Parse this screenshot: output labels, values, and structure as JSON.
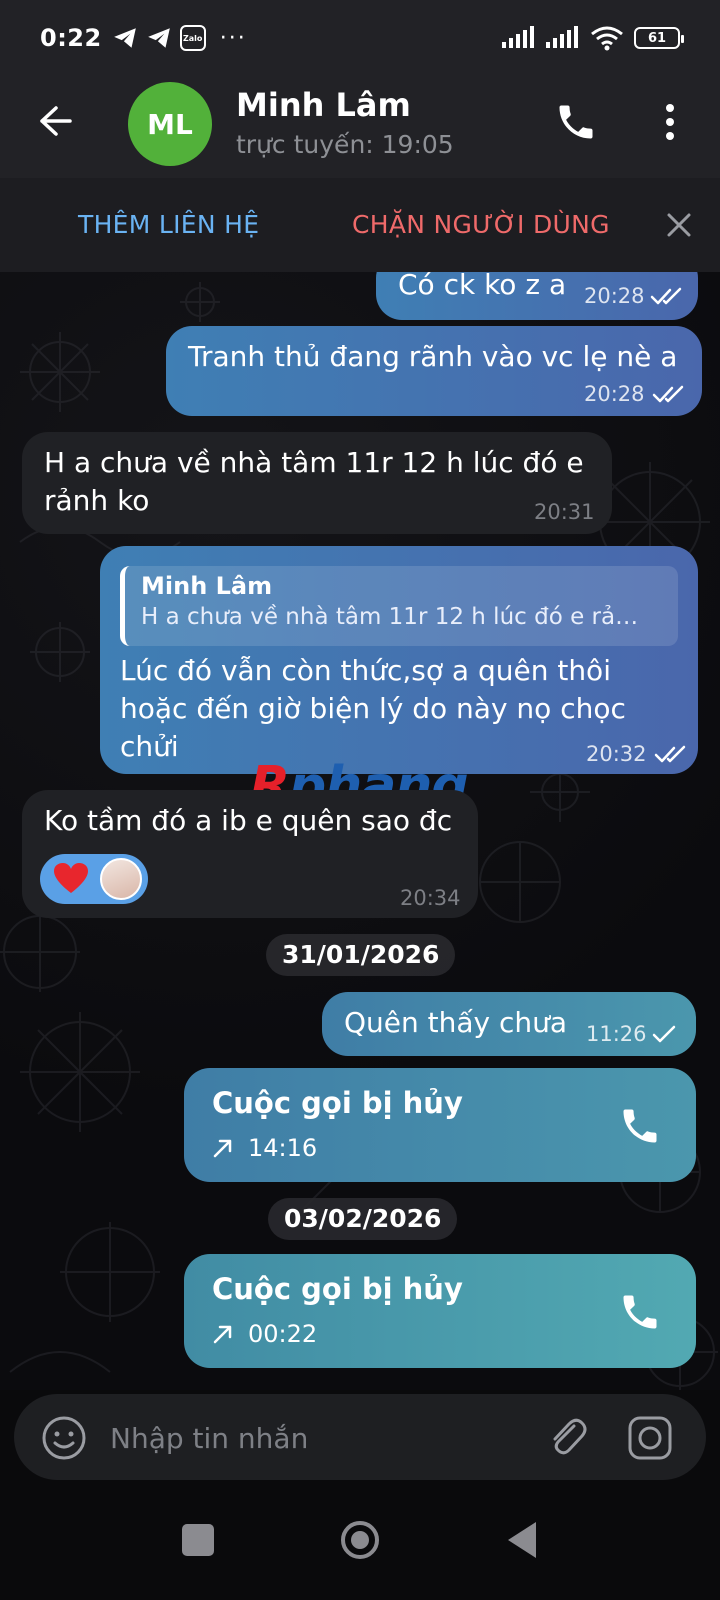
{
  "status_bar": {
    "time": "0:22",
    "zalo_label": "Zalo",
    "more": "···",
    "battery": "61"
  },
  "header": {
    "avatar_initials": "ML",
    "name": "Minh Lâm",
    "status": "trực tuyến: 19:05"
  },
  "action_bar": {
    "add_contact": "THÊM LIÊN HỆ",
    "block_user": "CHẶN NGƯỜI DÙNG"
  },
  "messages": [
    {
      "type": "outgoing",
      "text": "Có ck ko z a",
      "time": "20:28",
      "read": true
    },
    {
      "type": "outgoing",
      "text": "Tranh thủ đang rãnh vào vc lẹ nè a",
      "time": "20:28",
      "read": true
    },
    {
      "type": "incoming",
      "text_line1": "H a chưa về nhà tâm 11r 12 h lúc đó e",
      "text_line2": "rảnh ko",
      "time": "20:31"
    },
    {
      "type": "outgoing",
      "reply_name": "Minh Lâm",
      "reply_text": "H a chưa về nhà tâm 11r 12 h lúc đó e rả…",
      "text_line1": "Lúc đó vẫn còn thức,sợ a quên thôi",
      "text_line2": "hoặc đến giờ biện lý do này nọ chọc",
      "text_line3": "chửi",
      "time": "20:32",
      "read": true
    },
    {
      "type": "incoming",
      "text": "Ko tầm đó a ib e quên sao đc",
      "time": "20:34",
      "reaction": "heart"
    },
    {
      "type": "outgoing",
      "text": "Quên thấy chưa",
      "time": "11:26",
      "read": false
    },
    {
      "type": "call",
      "title": "Cuộc gọi bị hủy",
      "time": "14:16"
    },
    {
      "type": "call",
      "title": "Cuộc gọi bị hủy",
      "time": "00:22"
    }
  ],
  "dates": [
    "31/01/2026",
    "03/02/2026"
  ],
  "watermark": {
    "first": "R",
    "rest": "phang"
  },
  "composer": {
    "placeholder": "Nhập tin nhắn"
  },
  "colors": {
    "accent_blue": "#6ab3f3",
    "danger_red": "#ef6a6a",
    "avatar_green": "#52b13a"
  }
}
